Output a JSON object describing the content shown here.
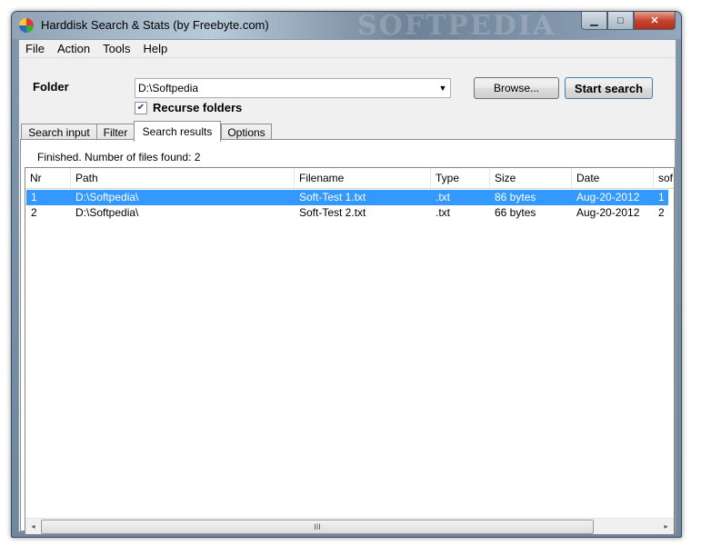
{
  "window": {
    "title": "Harddisk Search & Stats   (by Freebyte.com)",
    "watermark": "SOFTPEDIA",
    "minimize_icon": "minimize-icon",
    "maximize_icon": "maximize-icon",
    "close_icon": "close-icon"
  },
  "menu": {
    "items": [
      "File",
      "Action",
      "Tools",
      "Help"
    ]
  },
  "form": {
    "folder_label": "Folder",
    "folder_value": "D:\\Softpedia",
    "browse_label": "Browse...",
    "start_label": "Start search",
    "recurse_label": "Recurse folders",
    "recurse_checked": true
  },
  "tabs": [
    "Search input",
    "Filter",
    "Search results",
    "Options"
  ],
  "active_tab": "Search results",
  "results": {
    "status": "Finished. Number of files found: 2",
    "columns": [
      "Nr",
      "Path",
      "Filename",
      "Type",
      "Size",
      "Date",
      "sof"
    ],
    "rows": [
      [
        "1",
        "D:\\Softpedia\\",
        "Soft-Test 1.txt",
        ".txt",
        "86 bytes",
        "Aug-20-2012",
        "1"
      ],
      [
        "2",
        "D:\\Softpedia\\",
        "Soft-Test 2.txt",
        ".txt",
        "66 bytes",
        "Aug-20-2012",
        "2"
      ]
    ],
    "selected_row": 0
  },
  "scrollbar": {
    "left_arrow": "◂",
    "right_arrow": "▸",
    "grip": "III"
  },
  "colors": {
    "selection": "#3399ff",
    "window_frame": "#7f96ad"
  }
}
